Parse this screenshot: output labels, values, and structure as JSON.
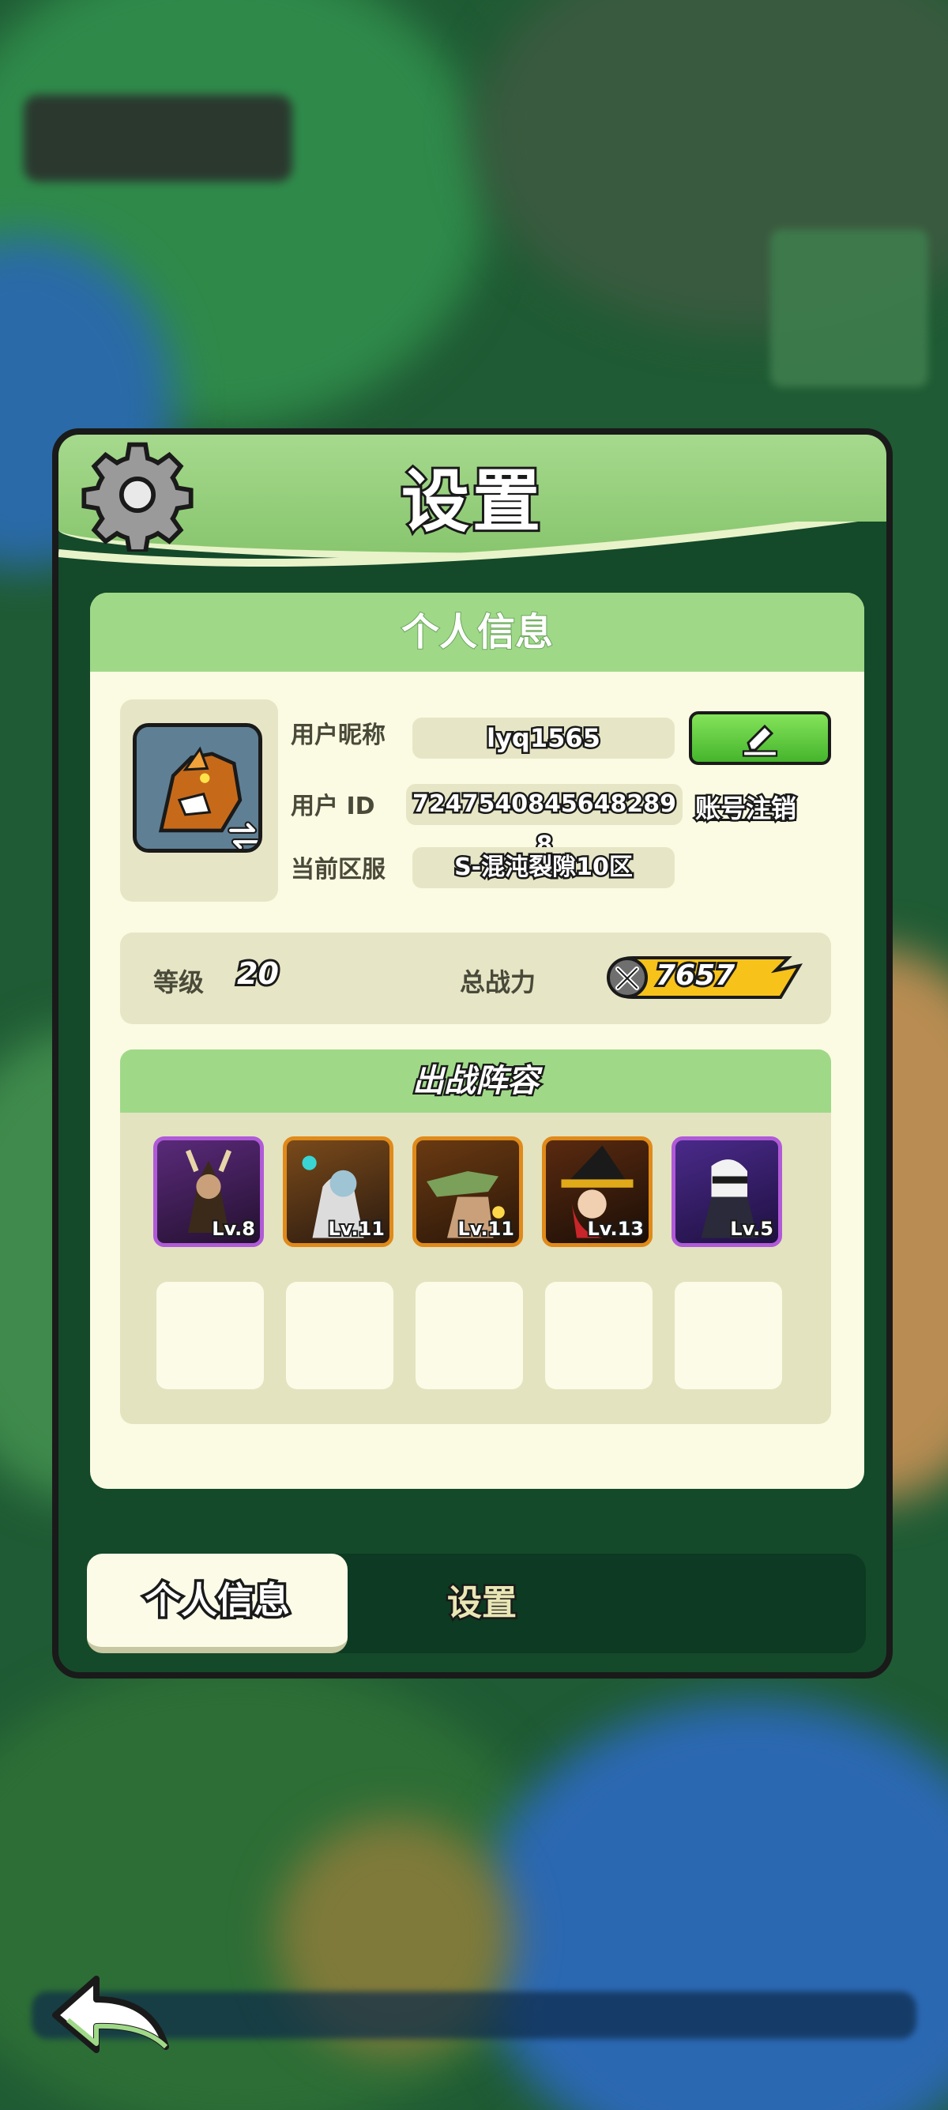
{
  "panel": {
    "title": "设置",
    "section_title": "个人信息"
  },
  "profile": {
    "nickname_label": "用户昵称",
    "nickname": "lyq1565",
    "id_label": "用户 ID",
    "user_id": "7247540845648289​8",
    "cancel_account": "账号注销",
    "server_label": "当前区服",
    "server": "S-混沌裂隙10区"
  },
  "stats": {
    "level_label": "等级",
    "level": "20",
    "power_label": "总战力",
    "power": "7657"
  },
  "lineup": {
    "title": "出战阵容",
    "heroes": [
      {
        "level": "Lv.8",
        "rarity": "purple"
      },
      {
        "level": "Lv.11",
        "rarity": "orange"
      },
      {
        "level": "Lv.11",
        "rarity": "orange"
      },
      {
        "level": "Lv.13",
        "rarity": "orange"
      },
      {
        "level": "Lv.5",
        "rarity": "purple"
      }
    ],
    "empty_slots": 5
  },
  "tabs": {
    "profile": "个人信息",
    "settings": "设置"
  },
  "colors": {
    "header_green": "#9fd988",
    "panel_dark": "#144a2a",
    "card_cream": "#fbfbe3",
    "edit_green": "#45b52c",
    "power_gold": "#f7c21a"
  }
}
